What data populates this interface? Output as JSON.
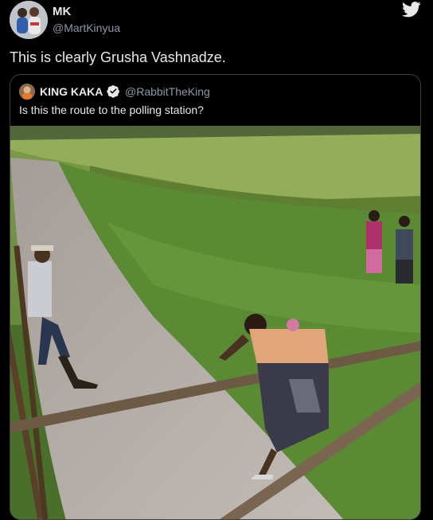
{
  "tweet": {
    "author_name": "MK",
    "author_handle": "@MartKinyua",
    "text": "This is clearly Grusha Vashnadze.",
    "avatar_icon": "user-avatar-photo",
    "platform_icon": "twitter-bird-icon"
  },
  "quoted_tweet": {
    "author_name": "KING KAKA",
    "author_handle": "@RabbitTheKing",
    "verified": true,
    "text": "Is this the route to the polling station?",
    "avatar_icon": "user-avatar-photo",
    "image": "photo-woman-crossing-water-channel-on-wooden-beams"
  },
  "colors": {
    "background": "#000000",
    "primary_text": "#e7e9ea",
    "secondary_text": "#8b98a5",
    "card_border": "#3c3f44",
    "verified_badge": "#e7e9ea"
  }
}
